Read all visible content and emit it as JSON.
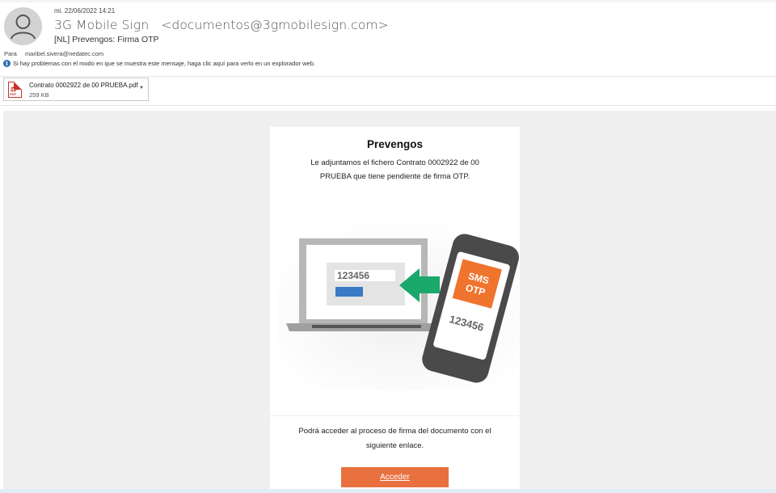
{
  "email": {
    "date": "mi. 22/06/2022 14:21",
    "from": "3G Mobile Sign   <documentos@3gmobilesign.com>",
    "subject": "[NL] Prevengos: Firma OTP",
    "to_label": "Para",
    "to_value": "maribel.sivera@nedatec.com",
    "info_message": "Si hay problemas con el modo en que se muestra este mensaje, haga clic aquí para verlo en un explorador web."
  },
  "attachment": {
    "name": "Contrato 0002922 de 00 PRUEBA.pdf",
    "size": "259 KB",
    "icon": "pdf-icon"
  },
  "card": {
    "title": "Prevengos",
    "intro": "Le adjuntamos el fichero Contrato 0002922 de 00 PRUEBA que tiene pendiente de firma OTP.",
    "access_text": "Podrá acceder al proceso de firma del documento con el siguiente enlace.",
    "access_button": "Acceder"
  },
  "illustration": {
    "screen_code": "123456",
    "phone_badge_line1": "SMS",
    "phone_badge_line2": "OTP",
    "phone_code": "123456"
  },
  "colors": {
    "accent_button": "#e8703e",
    "sms_badge": "#f0742e",
    "arrow": "#1aa86b",
    "input_blue": "#3a7ac4"
  }
}
